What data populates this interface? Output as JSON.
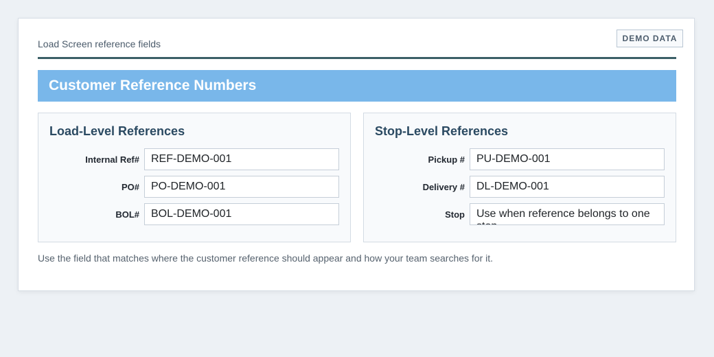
{
  "header": {
    "caption": "Load Screen reference fields",
    "badge": "DEMO DATA"
  },
  "banner": {
    "title": "Customer Reference Numbers"
  },
  "load_panel": {
    "title": "Load-Level References",
    "fields": [
      {
        "label": "Internal Ref#",
        "value": "REF-DEMO-001"
      },
      {
        "label": "PO#",
        "value": "PO-DEMO-001"
      },
      {
        "label": "BOL#",
        "value": "BOL-DEMO-001"
      }
    ]
  },
  "stop_panel": {
    "title": "Stop-Level References",
    "fields": [
      {
        "label": "Pickup #",
        "value": "PU-DEMO-001"
      },
      {
        "label": "Delivery #",
        "value": "DL-DEMO-001"
      },
      {
        "label": "Stop",
        "value": "Use when reference belongs to one stop"
      }
    ]
  },
  "footnote": "Use the field that matches where the customer reference should appear and how your team searches for it.",
  "colors": {
    "banner": "#79b7ea",
    "divider": "#3b5f67",
    "panel_title": "#2b4a62"
  }
}
